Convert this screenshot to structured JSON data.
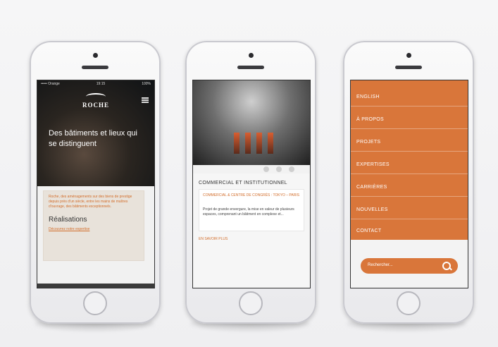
{
  "phone1": {
    "statusbar": {
      "left": "••••• Orange",
      "center": "19:15",
      "right": "100%"
    },
    "brand": "ROCHE",
    "hero_title": "Des bâtiments et lieux qui se distinguent",
    "card_text": "Roche, des aménagements sur des biens de prestige depuis près d'un siècle, entre les mains de maîtres d'ouvrage, des bâtiments exceptionnels.",
    "card_link": "Découvrez notre expertise",
    "section_title": "Réalisations"
  },
  "phone2": {
    "section_title": "COMMERCIAL ET INSTITUTIONNEL",
    "feature_link": "COMMERCIAL & CENTRE DE CONGRÈS : TOKYO – PARIS",
    "description": "Projet de grande envergure, la mise en valeur de plusieurs espaces, comprenant un bâtiment en complexe et...",
    "more": "EN SAVOIR PLUS"
  },
  "phone3": {
    "menu_items": [
      "ENGLISH",
      "À PROPOS",
      "PROJETS",
      "EXPERTISES",
      "CARRIÈRES",
      "NOUVELLES",
      "CONTACT"
    ],
    "search_placeholder": "Rechercher..."
  }
}
